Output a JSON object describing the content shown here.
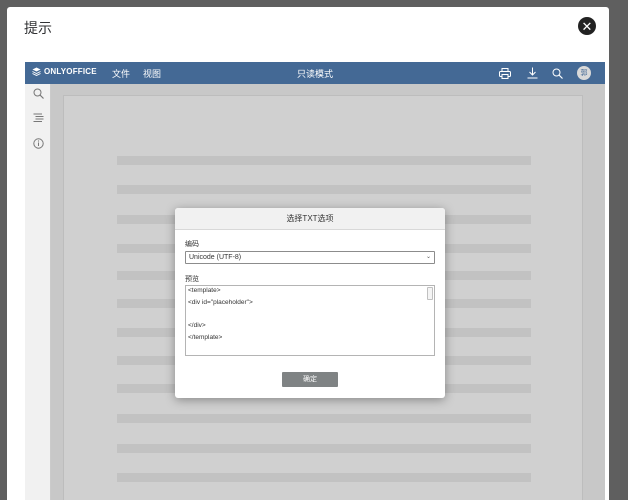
{
  "outer_dialog": {
    "title": "提示"
  },
  "toolbar": {
    "brand": "ONLYOFFICE",
    "menu": [
      "文件",
      "视图"
    ],
    "mode": "只读模式",
    "avatar_initial": "郭"
  },
  "modal": {
    "title": "选择TXT选项",
    "encoding_label": "编码",
    "encoding_value": "Unicode (UTF-8)",
    "preview_label": "预览",
    "preview_lines": [
      "<template>",
      "<div id=\"placeholder\">",
      "",
      "</div>",
      "</template>"
    ],
    "ok_label": "确定"
  },
  "icons": {
    "close": "close-icon",
    "print": "print-icon",
    "download": "download-icon",
    "search": "search-icon",
    "left_panel": [
      "search-icon",
      "navigation-icon",
      "info-icon"
    ]
  },
  "colors": {
    "toolbar": "#446995",
    "ok_button": "#7f8384"
  }
}
